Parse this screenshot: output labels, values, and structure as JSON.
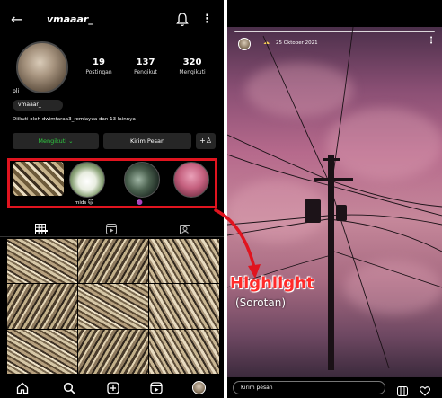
{
  "profile": {
    "username": "vmaaar_",
    "display_name": "pli",
    "handle_chip": "vmaaar_",
    "stats": [
      {
        "value": "19",
        "label": "Postingan"
      },
      {
        "value": "137",
        "label": "Pengikut"
      },
      {
        "value": "320",
        "label": "Mengikuti"
      }
    ],
    "followed_by": "Diikuti oleh dwimtaraa3_remiayua dan 13 lainnya",
    "buttons": {
      "following": "Mengikuti ⌄",
      "message": "Kirim Pesan",
      "add_person": "+♙"
    }
  },
  "highlights": {
    "labels": [
      "",
      "mids 🐱",
      "🟣",
      ""
    ]
  },
  "story": {
    "date": "25 Oktober 2021",
    "emoji": "☁",
    "reply_placeholder": "Kirim pesan"
  },
  "annotation": {
    "title": "Highlight",
    "subtitle": "(Sorotan)",
    "color": "#ff2a2a"
  },
  "colors": {
    "highlight_box": "#e0141f",
    "following_text": "#2ecc40"
  }
}
